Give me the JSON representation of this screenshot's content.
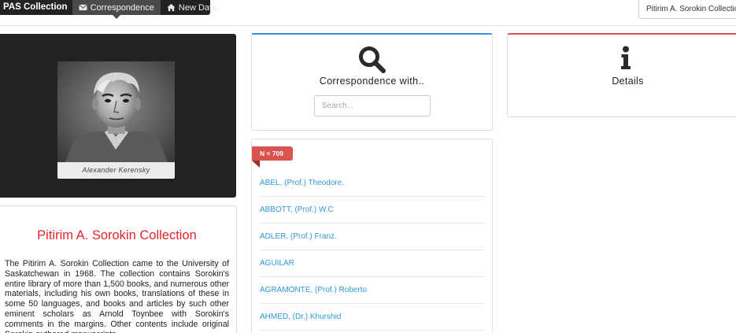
{
  "navbar": {
    "brand": "PAS Collection",
    "items": [
      {
        "label": "Correspondence",
        "icon": "envelope-icon",
        "active": true
      },
      {
        "label": "New Data",
        "icon": "home-icon",
        "active": false
      }
    ],
    "search_value": "Pitirim A. Sorokin Collection"
  },
  "portrait": {
    "caption": "Alexander Kerensky"
  },
  "about": {
    "title": "Pitirim A. Sorokin Collection",
    "body": "The Pitirim A. Sorokin Collection came to the University of Saskatchewan in 1968. The collection contains Sorokin's entire library of more than 1,500 books, and numerous other materials, including his own books, translations of these in some 50 languages, and books and articles by such other eminent scholars as Arnold Toynbee with Sorokin's comments in the margins. Other contents include original Sorokin-authored manuscripts,"
  },
  "correspondence": {
    "heading": "Correspondence with..",
    "search_placeholder": "Search...",
    "count_label": "N = 709",
    "entries": [
      "ABEL, (Prof.) Theodore.",
      "ABBOTT, (Prof.) W.C",
      "ADLER, (Prof.) Franz.",
      "AGUILAR",
      "AGRAMONTE, (Prof.) Roberto",
      "AHMED, (Dr.) Khurshid"
    ]
  },
  "details": {
    "heading": "Details"
  },
  "colors": {
    "accent_blue": "#3a8fd9",
    "accent_red": "#d9534f",
    "title_red": "#e3222b",
    "link_blue": "#2f9ad6",
    "navbar_dark": "#222222"
  }
}
